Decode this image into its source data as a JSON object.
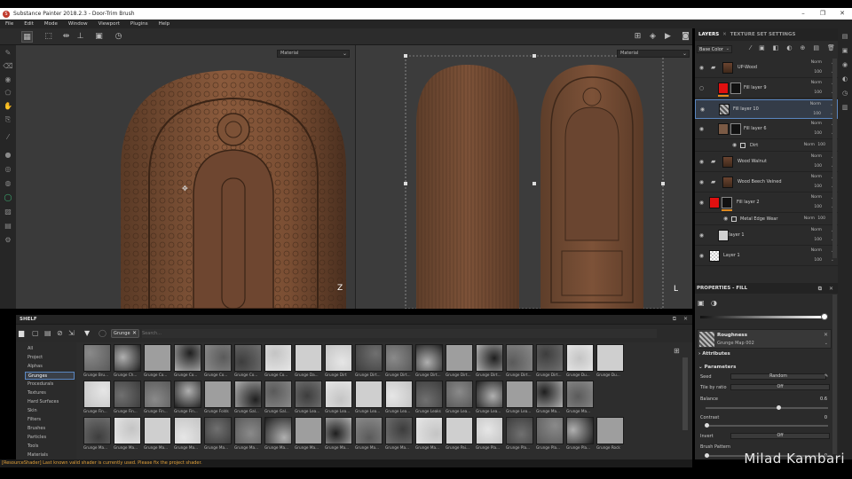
{
  "window": {
    "title": "Substance Painter 2018.2.3 - Door-Trim Brush",
    "app_icon": "substance-painter-icon"
  },
  "menu": [
    "File",
    "Edit",
    "Mode",
    "Window",
    "Viewport",
    "Plugins",
    "Help"
  ],
  "viewport": {
    "left_material": "Material",
    "right_material": "Material"
  },
  "shelf": {
    "title": "SHELF",
    "filter_tag": "Grunge",
    "search_placeholder": "Search...",
    "categories": [
      "All",
      "Project",
      "Alphas",
      "Grunges",
      "Procedurals",
      "Textures",
      "Hard Surfaces",
      "Skin",
      "Filters",
      "Brushes",
      "Particles",
      "Tools",
      "Materials"
    ],
    "selected_category": "Grunges",
    "thumbnails": [
      "Grunge Bru...",
      "Grunge Ch...",
      "Grunge Co...",
      "Grunge Co...",
      "Grunge Co...",
      "Grunge Co...",
      "Grunge Co...",
      "Grunge Da...",
      "Grunge Dirt",
      "Grunge Dirt...",
      "Grunge Dirt...",
      "Grunge Dirt...",
      "Grunge Dirt...",
      "Grunge Dirt...",
      "Grunge Dirt...",
      "Grunge Dirt...",
      "Grunge Du...",
      "Grunge Du...",
      "Grunge Fin...",
      "Grunge Fin...",
      "Grunge Fin...",
      "Grunge Fin...",
      "Grunge Folds",
      "Grunge Gal...",
      "Grunge Gal...",
      "Grunge Lea...",
      "Grunge Lea...",
      "Grunge Lea...",
      "Grunge Lea...",
      "Grunge Leaks",
      "Grunge Lea...",
      "Grunge Lea...",
      "Grunge Lea...",
      "Grunge Ma...",
      "Grunge Ma...",
      "Grunge Ma...",
      "Grunge Ma...",
      "Grunge Ma...",
      "Grunge Ma...",
      "Grunge Ma...",
      "Grunge Ma...",
      "Grunge Ma...",
      "Grunge Ma...",
      "Grunge Ma...",
      "Grunge Ma...",
      "Grunge Ma...",
      "Grunge Ma...",
      "Grunge Pai...",
      "Grunge Pla...",
      "Grunge Pla...",
      "Grunge Pla...",
      "Grunge Pla...",
      "Grunge Rock"
    ]
  },
  "status": {
    "message": "[ResourceShader] Last known valid shader is currently used. Please fix the project shader."
  },
  "layers_panel": {
    "tabs": [
      "LAYERS",
      "TEXTURE SET SETTINGS"
    ],
    "channel": "Base Color",
    "layers": [
      {
        "name": "UP-Wood",
        "blend": "Norm",
        "opacity": "100",
        "kind": "folder"
      },
      {
        "name": "Fill layer 9",
        "blend": "Norm",
        "opacity": "100",
        "kind": "fill"
      },
      {
        "name": "Fill layer 10",
        "blend": "Norm",
        "opacity": "100",
        "kind": "fill"
      },
      {
        "name": "Fill layer 6",
        "blend": "Norm",
        "opacity": "100",
        "kind": "fill"
      },
      {
        "name": "Dirt",
        "blend": "Norm",
        "opacity": "100",
        "kind": "sub"
      },
      {
        "name": "Wood Walnut",
        "blend": "Norm",
        "opacity": "100",
        "kind": "folder"
      },
      {
        "name": "Wood Beech Veined",
        "blend": "Norm",
        "opacity": "100",
        "kind": "folder"
      },
      {
        "name": "Fill layer 2",
        "blend": "Norm",
        "opacity": "100",
        "kind": "fill"
      },
      {
        "name": "Metal Edge Wear",
        "blend": "Norm",
        "opacity": "100",
        "kind": "sub"
      },
      {
        "name": "Fill layer 1",
        "blend": "Norm",
        "opacity": "100",
        "kind": "fill"
      },
      {
        "name": "Layer 1",
        "blend": "Norm",
        "opacity": "100",
        "kind": "paint"
      }
    ]
  },
  "properties": {
    "title": "PROPERTIES - FILL",
    "roughness_title": "Roughness",
    "roughness_map": "Grunge Map 002",
    "attributes_label": "Attributes",
    "parameters_label": "Parameters",
    "seed_label": "Seed",
    "seed_value": "Random",
    "tile_label": "Tile by ratio",
    "tile_value": "Off",
    "balance_label": "Balance",
    "balance_value": "0.6",
    "contrast_label": "Contrast",
    "contrast_value": "0",
    "invert_label": "Invert",
    "invert_value": "Off",
    "brush_pattern_label": "Brush Pattern",
    "brush_pattern_value": "0"
  },
  "watermark": "Milad Kambari",
  "colors": {
    "accent": "#5a86c0",
    "warning": "#e3a23b",
    "fill_red": "#e01010"
  }
}
